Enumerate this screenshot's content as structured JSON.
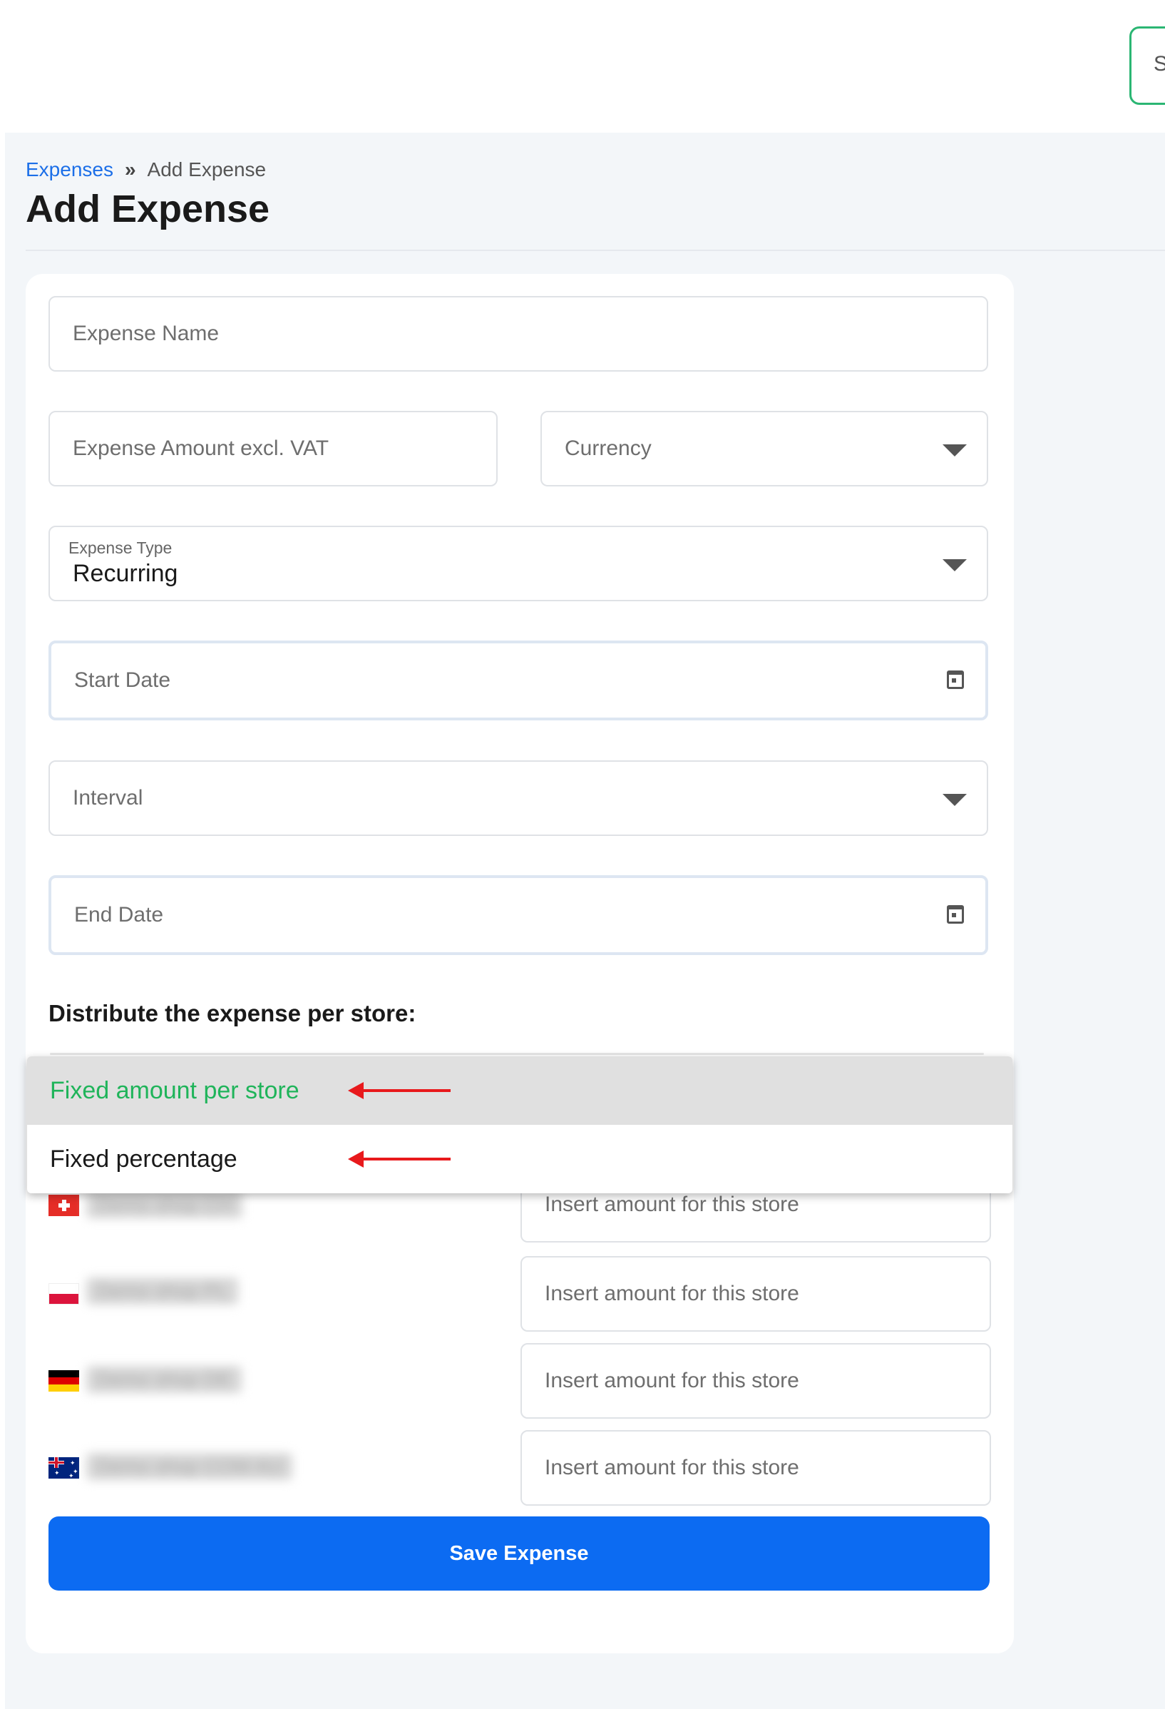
{
  "header": {
    "top_button_label": "S"
  },
  "breadcrumb": {
    "parent": "Expenses",
    "separator": "»",
    "current": "Add Expense"
  },
  "page": {
    "title": "Add Expense"
  },
  "form": {
    "expense_name_placeholder": "Expense Name",
    "amount_placeholder": "Expense Amount excl. VAT",
    "currency_placeholder": "Currency",
    "expense_type_label": "Expense Type",
    "expense_type_value": "Recurring",
    "start_date_placeholder": "Start Date",
    "interval_placeholder": "Interval",
    "end_date_placeholder": "End Date",
    "distribute_title": "Distribute the expense per store:",
    "save_label": "Save Expense"
  },
  "distribution_menu": {
    "options": [
      {
        "label": "Fixed amount per store",
        "selected": true
      },
      {
        "label": "Fixed percentage",
        "selected": false
      }
    ],
    "highlight_color": "#1fb45a",
    "annotation_arrow_color": "#e8191c"
  },
  "stores": [
    {
      "flag_icon": "switzerland-flag-icon",
      "name": "Demo shop CH",
      "amount_placeholder": "Insert amount for this store"
    },
    {
      "flag_icon": "poland-flag-icon",
      "name": "Demo shop PL",
      "amount_placeholder": "Insert amount for this store"
    },
    {
      "flag_icon": "germany-flag-icon",
      "name": "Demo shop DE",
      "amount_placeholder": "Insert amount for this store"
    },
    {
      "flag_icon": "australia-flag-icon",
      "name": "Demo shop COM AU",
      "amount_placeholder": "Insert amount for this store"
    }
  ],
  "colors": {
    "primary": "#0c6bf2",
    "accent_green": "#2bb673",
    "link": "#1c6fe8",
    "background": "#f3f6f9"
  }
}
